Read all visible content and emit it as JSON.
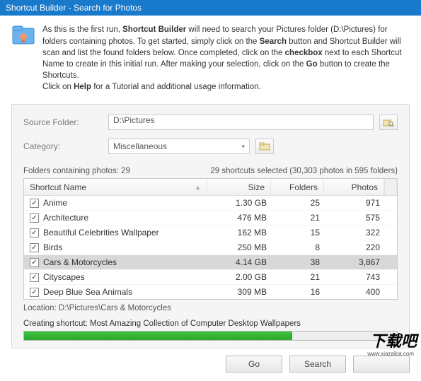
{
  "titlebar": "Shortcut Builder - Search for Photos",
  "intro": {
    "l1a": "As this is the first run, ",
    "l1b": "Shortcut Builder",
    "l1c": " will need to search your Pictures folder (D:\\Pictures) for folders containing photos.  To get started, simply click on the ",
    "l1d": "Search",
    "l1e": " button and Shortcut Builder will scan and list the found folders below.  Once completed, click on the ",
    "l1f": "checkbox",
    "l1g": " next to each Shortcut Name to create in this initial run.  After making your selection, click on the ",
    "l1h": "Go",
    "l1i": " button to create the Shortcuts.",
    "l2a": "Click on ",
    "l2b": "Help",
    "l2c": " for a Tutorial and additional usage information."
  },
  "form": {
    "source_label": "Source Folder:",
    "source_value": "D:\\Pictures",
    "category_label": "Category:",
    "category_value": "Miscellaneous"
  },
  "stats": {
    "left": "Folders containing photos: 29",
    "right": "29 shortcuts selected (30,303 photos in 595 folders)"
  },
  "columns": {
    "name": "Shortcut Name",
    "size": "Size",
    "folders": "Folders",
    "photos": "Photos"
  },
  "rows": [
    {
      "name": "Anime",
      "size": "1.30 GB",
      "folders": "25",
      "photos": "971"
    },
    {
      "name": "Architecture",
      "size": "476 MB",
      "folders": "21",
      "photos": "575"
    },
    {
      "name": "Beautiful Celebrities Wallpaper",
      "size": "162 MB",
      "folders": "15",
      "photos": "322"
    },
    {
      "name": "Birds",
      "size": "250 MB",
      "folders": "8",
      "photos": "220"
    },
    {
      "name": "Cars & Motorcycles",
      "size": "4.14 GB",
      "folders": "38",
      "photos": "3,867"
    },
    {
      "name": "Cityscapes",
      "size": "2.00 GB",
      "folders": "21",
      "photos": "743"
    },
    {
      "name": "Deep Blue Sea Animals",
      "size": "309 MB",
      "folders": "16",
      "photos": "400"
    }
  ],
  "selected_row_index": 4,
  "location": "Location: D:\\Pictures\\Cars & Motorcycles",
  "progress": {
    "label": "Creating shortcut: Most Amazing Collection of Computer Desktop Wallpapers",
    "percent": 72
  },
  "buttons": {
    "go": "Go",
    "search": "Search",
    "third": " "
  },
  "watermark": {
    "main": "下载吧",
    "sub": "www.xiazaiba.com"
  }
}
